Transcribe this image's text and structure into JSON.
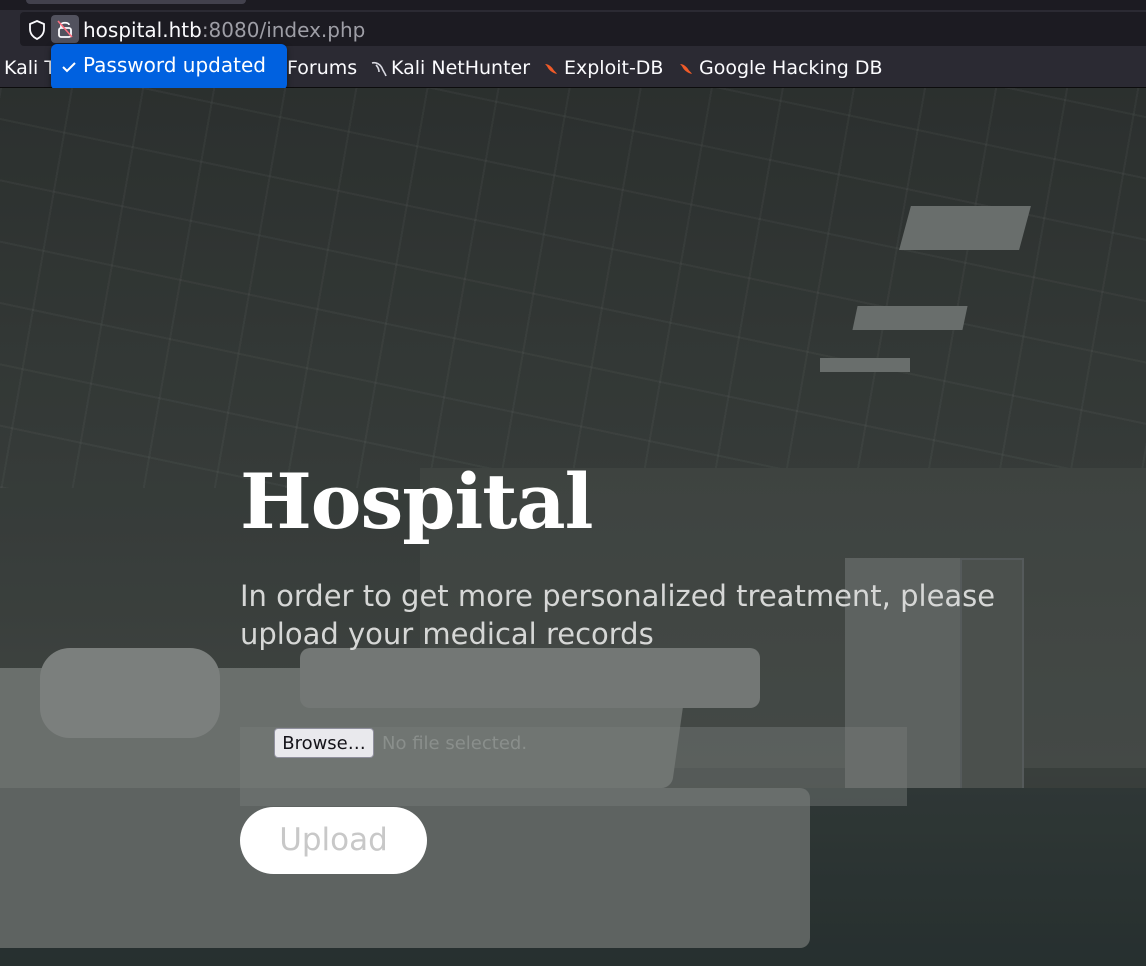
{
  "browser": {
    "url_host": "hospital.htb",
    "url_rest": ":8080/index.php"
  },
  "bookmarks": [
    {
      "label": "Kali T",
      "icon": "kali-icon"
    },
    {
      "label": "Forums",
      "icon": ""
    },
    {
      "label": "Kali NetHunter",
      "icon": "kali-dragon-icon"
    },
    {
      "label": "Exploit-DB",
      "icon": "exploit-db-icon"
    },
    {
      "label": "Google Hacking DB",
      "icon": "exploit-db-icon"
    }
  ],
  "toast": {
    "message": "Password updated",
    "icon": "checkmark-icon",
    "color": "#0061e0"
  },
  "page": {
    "title": "Hospital",
    "subtitle": "In order to get more personalized treatment, please upload your medical records",
    "browse_label": "Browse…",
    "file_status": "No file selected.",
    "upload_label": "Upload"
  }
}
